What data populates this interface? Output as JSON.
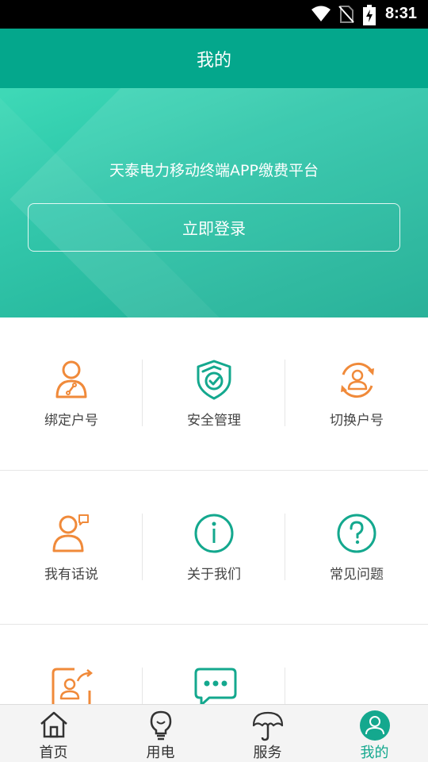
{
  "status_bar": {
    "time": "8:31"
  },
  "header": {
    "title": "我的"
  },
  "hero": {
    "slogan": "天泰电力移动终端APP缴费平台",
    "login_label": "立即登录"
  },
  "menu": {
    "row1": [
      {
        "label": "绑定户号",
        "icon": "bind-account-icon"
      },
      {
        "label": "安全管理",
        "icon": "security-shield-icon"
      },
      {
        "label": "切换户号",
        "icon": "switch-account-icon"
      }
    ],
    "row2": [
      {
        "label": "我有话说",
        "icon": "feedback-user-icon"
      },
      {
        "label": "关于我们",
        "icon": "info-icon"
      },
      {
        "label": "常见问题",
        "icon": "question-icon"
      }
    ],
    "row3": [
      {
        "label": "",
        "icon": "share-user-icon"
      },
      {
        "label": "",
        "icon": "message-bubble-icon"
      }
    ]
  },
  "tabs": [
    {
      "label": "首页",
      "icon": "home-icon"
    },
    {
      "label": "用电",
      "icon": "lightbulb-icon"
    },
    {
      "label": "服务",
      "icon": "umbrella-icon"
    },
    {
      "label": "我的",
      "icon": "user-icon"
    }
  ],
  "colors": {
    "primary": "#04a78c",
    "orange": "#f08a3a",
    "teal": "#14a88e"
  }
}
